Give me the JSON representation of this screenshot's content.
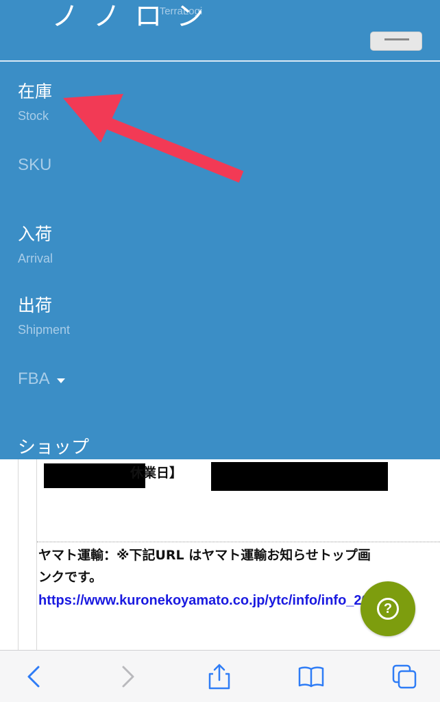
{
  "header": {
    "site_label": "TerraLogi",
    "brand_partial": "ノ ノ ロ ン"
  },
  "nav": {
    "stock": {
      "ja": "在庫",
      "en": "Stock"
    },
    "sku": {
      "label": "SKU"
    },
    "arrival": {
      "ja": "入荷",
      "en": "Arrival"
    },
    "shipment": {
      "ja": "出荷",
      "en": "Shipment"
    },
    "fba": {
      "label": "FBA"
    },
    "shop": {
      "ja": "ショップ"
    }
  },
  "content": {
    "holiday_label": "休業日】",
    "yamato_line1": "ヤマト運輸：※下記URL はヤマト運輸お知らせトップ画",
    "yamato_line2": "ンクです。",
    "yamato_url": "https://www.kuronekoyamato.co.jp/ytc/info/info_20"
  },
  "help": {
    "symbol": "?"
  },
  "colors": {
    "menu_bg": "#3b8ec6",
    "muted_text": "#a9cde8",
    "annotation_arrow": "#f23a55",
    "help_button": "#7d9d0e",
    "link": "#1a1ae0",
    "ios_blue": "#2e7cf6"
  },
  "toolbar": {
    "icons": [
      "back-icon",
      "forward-icon",
      "share-icon",
      "bookmarks-icon",
      "tabs-icon"
    ]
  }
}
